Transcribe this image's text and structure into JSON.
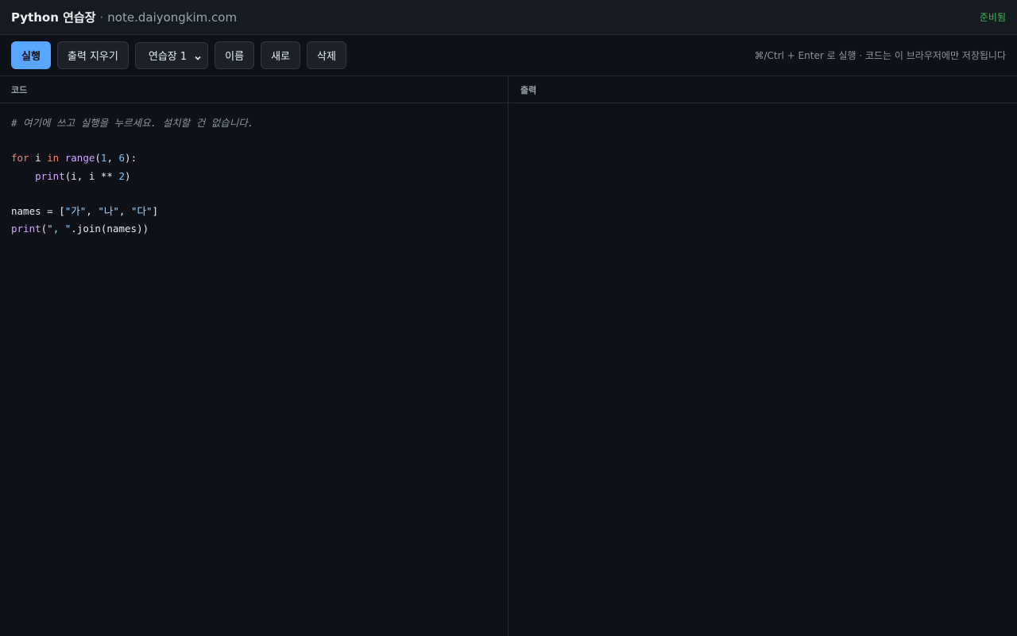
{
  "header": {
    "app_title": "Python 연습장",
    "separator": "·",
    "domain": "note.daiyongkim.com",
    "status": "준비됨"
  },
  "toolbar": {
    "run_label": "실행",
    "clear_output_label": "출력 지우기",
    "notebook_select": {
      "selected": "연습장 1"
    },
    "rename_label": "이름",
    "new_label": "새로",
    "delete_label": "삭제",
    "hint": "⌘/Ctrl + Enter 로 실행 · 코드는 이 브라우저에만 저장됩니다"
  },
  "editor": {
    "header": "코드",
    "lines": [
      [
        {
          "t": "# 여기에 쓰고 실행을 누르세요. 설치할 건 없습니다.",
          "c": "comment"
        }
      ],
      [],
      [
        {
          "t": "for",
          "c": "kw"
        },
        {
          "t": " i ",
          "c": ""
        },
        {
          "t": "in",
          "c": "kw"
        },
        {
          "t": " ",
          "c": ""
        },
        {
          "t": "range",
          "c": "fn"
        },
        {
          "t": "(",
          "c": ""
        },
        {
          "t": "1",
          "c": "num"
        },
        {
          "t": ", ",
          "c": ""
        },
        {
          "t": "6",
          "c": "num"
        },
        {
          "t": "):",
          "c": ""
        }
      ],
      [
        {
          "t": "    ",
          "c": ""
        },
        {
          "t": "print",
          "c": "fn"
        },
        {
          "t": "(i, i ** ",
          "c": ""
        },
        {
          "t": "2",
          "c": "num"
        },
        {
          "t": ")",
          "c": ""
        }
      ],
      [],
      [
        {
          "t": "names = [",
          "c": ""
        },
        {
          "t": "\"가\"",
          "c": "str"
        },
        {
          "t": ", ",
          "c": ""
        },
        {
          "t": "\"나\"",
          "c": "str"
        },
        {
          "t": ", ",
          "c": ""
        },
        {
          "t": "\"다\"",
          "c": "str"
        },
        {
          "t": "]",
          "c": ""
        }
      ],
      [
        {
          "t": "print",
          "c": "fn"
        },
        {
          "t": "(",
          "c": ""
        },
        {
          "t": "\", \"",
          "c": "str"
        },
        {
          "t": ".join(names))",
          "c": ""
        }
      ]
    ]
  },
  "output": {
    "header": "출력",
    "text": ""
  }
}
